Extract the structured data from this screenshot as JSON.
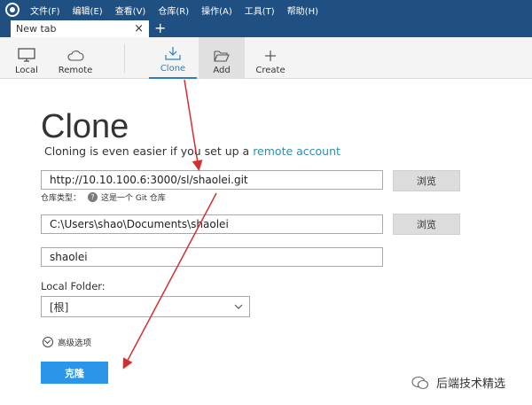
{
  "menu": [
    "文件(F)",
    "编辑(E)",
    "查看(V)",
    "仓库(R)",
    "操作(A)",
    "工具(T)",
    "帮助(H)"
  ],
  "tab": {
    "label": "New tab",
    "close": "×",
    "add": "+"
  },
  "toolbar": {
    "local": "Local",
    "remote": "Remote",
    "clone": "Clone",
    "add": "Add",
    "create": "Create"
  },
  "main": {
    "title": "Clone",
    "subtitle_prefix": "Cloning is even easier if you set up a ",
    "subtitle_link": "remote account",
    "url_value": "http://10.10.100.6:3000/sl/shaolei.git",
    "browse_label": "浏览",
    "repo_type_label": "仓库类型：",
    "repo_type_value": "这是一个 Git 仓库",
    "help_glyph": "?",
    "path_value": "C:\\Users\\shao\\Documents\\shaolei",
    "name_value": "shaolei",
    "local_folder_label": "Local Folder:",
    "local_folder_value": "[根]",
    "advanced_label": "高级选项",
    "clone_button": "克隆"
  },
  "watermark": {
    "text": "后端技术精选"
  },
  "colors": {
    "titlebar": "#205081",
    "accent": "#2c7fbe",
    "link": "#2c8fb0",
    "clone_button": "#2b95e9",
    "arrow": "#d32f2f"
  },
  "icons": {
    "local": "monitor-icon",
    "remote": "cloud-icon",
    "clone": "download-tray-icon",
    "add": "folder-open-icon",
    "create": "plus-icon"
  }
}
